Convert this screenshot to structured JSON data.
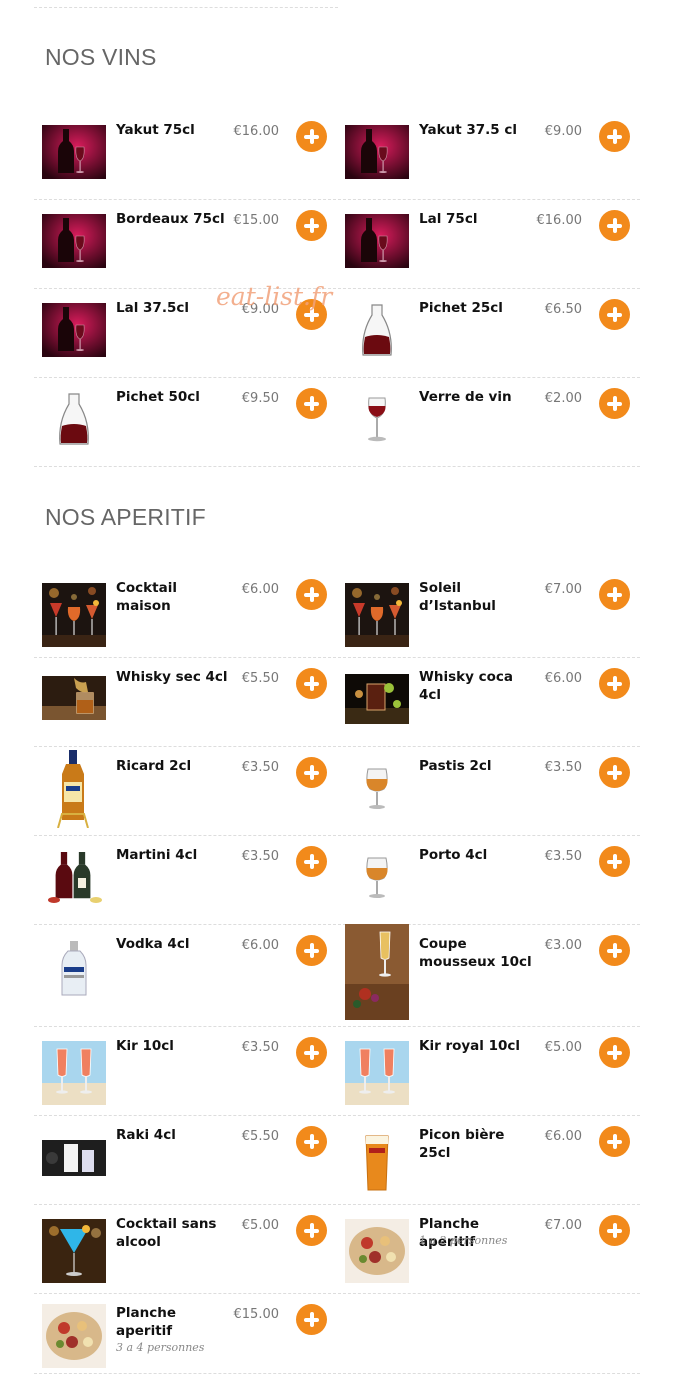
{
  "watermark": "eat-list.fr",
  "accent_color": "#f28a1b",
  "sections": [
    {
      "title": "NOS VINS",
      "items": [
        {
          "name": "Yakut 75cl",
          "price": "€16.00",
          "icon": "wine-bottle-icon"
        },
        {
          "name": "Yakut 37.5 cl",
          "price": "€9.00",
          "icon": "wine-bottle-icon"
        },
        {
          "name": "Bordeaux 75cl",
          "price": "€15.00",
          "icon": "wine-bottle-icon"
        },
        {
          "name": "Lal 75cl",
          "price": "€16.00",
          "icon": "wine-bottle-icon"
        },
        {
          "name": "Lal 37.5cl",
          "price": "€9.00",
          "icon": "wine-bottle-icon"
        },
        {
          "name": "Pichet 25cl",
          "price": "€6.50",
          "icon": "carafe-icon"
        },
        {
          "name": "Pichet 50cl",
          "price": "€9.50",
          "icon": "carafe-icon"
        },
        {
          "name": "Verre de vin",
          "price": "€2.00",
          "icon": "wine-glass-icon"
        }
      ]
    },
    {
      "title": "NOS APERITIF",
      "items": [
        {
          "name": "Cocktail maison",
          "price": "€6.00",
          "icon": "cocktail-photo-icon"
        },
        {
          "name": "Soleil d’Istanbul",
          "price": "€7.00",
          "icon": "cocktail-photo-icon"
        },
        {
          "name": "Whisky sec 4cl",
          "price": "€5.50",
          "icon": "whisky-glass-icon"
        },
        {
          "name": "Whisky coca 4cl",
          "price": "€6.00",
          "icon": "whisky-coca-icon"
        },
        {
          "name": "Ricard 2cl",
          "price": "€3.50",
          "icon": "ricard-bottle-icon"
        },
        {
          "name": "Pastis 2cl",
          "price": "€3.50",
          "icon": "tasting-glass-icon"
        },
        {
          "name": "Martini 4cl",
          "price": "€3.50",
          "icon": "martini-bottles-icon"
        },
        {
          "name": "Porto 4cl",
          "price": "€3.50",
          "icon": "tasting-glass-icon"
        },
        {
          "name": "Vodka 4cl",
          "price": "€6.00",
          "icon": "vodka-bottle-icon"
        },
        {
          "name": "Coupe mousseux 10cl",
          "price": "€3.00",
          "icon": "champagne-flute-icon"
        },
        {
          "name": "Kir 10cl",
          "price": "€3.50",
          "icon": "kir-glasses-icon"
        },
        {
          "name": "Kir royal 10cl",
          "price": "€5.00",
          "icon": "kir-glasses-icon"
        },
        {
          "name": "Raki 4cl",
          "price": "€5.50",
          "icon": "raki-glass-icon"
        },
        {
          "name": "Picon bière 25cl",
          "price": "€6.00",
          "icon": "beer-glass-icon"
        },
        {
          "name": "Cocktail sans alcool",
          "price": "€5.00",
          "icon": "blue-cocktail-icon"
        },
        {
          "name": "Planche aperitif",
          "desc": "1 a 2 personnes",
          "price": "€7.00",
          "icon": "platter-icon"
        },
        {
          "name": "Planche aperitif",
          "desc": "3 a 4 personnes",
          "price": "€15.00",
          "icon": "platter-icon"
        }
      ]
    }
  ]
}
